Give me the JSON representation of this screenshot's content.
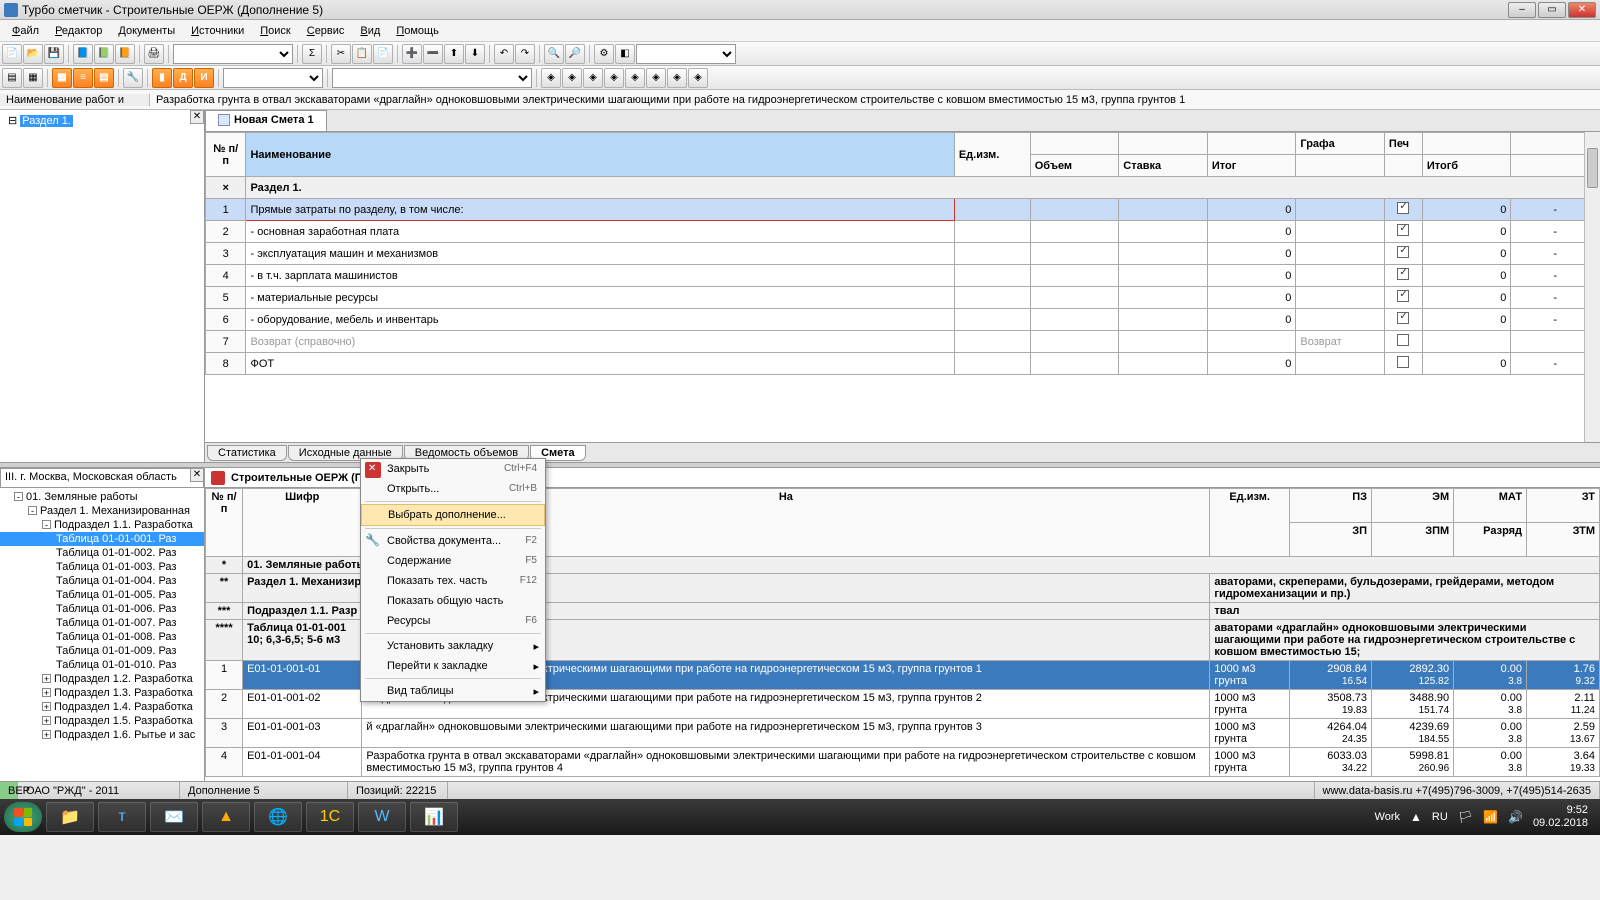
{
  "title": "Турбо сметчик - Строительные ОЕРЖ (Дополнение 5)",
  "menu": [
    "Файл",
    "Редактор",
    "Документы",
    "Источники",
    "Поиск",
    "Сервис",
    "Вид",
    "Помощь"
  ],
  "formula": {
    "label": "Наименование работ и",
    "value": "Разработка грунта в отвал экскаваторами «драглайн» одноковшовыми электрическими шагающими при работе на гидроэнергетическом строительстве с ковшом вместимостью 15 м3, группа грунтов 1"
  },
  "sections_tree": {
    "root": "Раздел 1."
  },
  "doc_tab": "Новая Смета 1",
  "est_headers": {
    "num": "№ п/п",
    "name": "Наименование",
    "unit": "Ед.изм.",
    "vol": "Объем",
    "rate": "Ставка",
    "itog": "Итог",
    "grafa": "Графа",
    "pech": "Печ",
    "itogb": "Итогб"
  },
  "est_section": "Раздел 1.",
  "est_rows": [
    {
      "n": "1",
      "name": "Прямые затраты по разделу, в том числе:",
      "itog": "0",
      "pech": true,
      "itogb": "0",
      "dash": "-",
      "sel": true
    },
    {
      "n": "2",
      "name": "   - основная заработная плата",
      "itog": "0",
      "pech": true,
      "itogb": "0",
      "dash": "-"
    },
    {
      "n": "3",
      "name": "   - эксплуатация машин и механизмов",
      "itog": "0",
      "pech": true,
      "itogb": "0",
      "dash": "-"
    },
    {
      "n": "4",
      "name": "     - в т.ч. зарплата машинистов",
      "itog": "0",
      "pech": true,
      "itogb": "0",
      "dash": "-"
    },
    {
      "n": "5",
      "name": "   - материальные ресурсы",
      "itog": "0",
      "pech": true,
      "itogb": "0",
      "dash": "-"
    },
    {
      "n": "6",
      "name": "   - оборудование, мебель и инвентарь",
      "itog": "0",
      "pech": true,
      "itogb": "0",
      "dash": "-"
    },
    {
      "n": "7",
      "name": "Возврат (справочно)",
      "itog": "",
      "pech": false,
      "itogb": "Возврат",
      "dash": "",
      "gray": true
    },
    {
      "n": "8",
      "name": "ФОТ",
      "itog": "0",
      "pech": false,
      "itogb": "0",
      "dash": "-"
    }
  ],
  "est_bottom_tabs": [
    "Статистика",
    "Исходные данные",
    "Ведомость объемов",
    "Смета"
  ],
  "est_bottom_active": 3,
  "db_region": "III. г. Москва, Московская область",
  "db_tree": {
    "root": "01. Земляные работы",
    "sec1": "Раздел 1. Механизированная",
    "sub": "Подраздел 1.1. Разработка",
    "tables": [
      "Таблица 01-01-001. Раз",
      "Таблица 01-01-002. Раз",
      "Таблица 01-01-003. Раз",
      "Таблица 01-01-004. Раз",
      "Таблица 01-01-005. Раз",
      "Таблица 01-01-006. Раз",
      "Таблица 01-01-007. Раз",
      "Таблица 01-01-008. Раз",
      "Таблица 01-01-009. Раз",
      "Таблица 01-01-010. Раз"
    ],
    "subs": [
      "Подраздел 1.2. Разработка",
      "Подраздел 1.3. Разработка",
      "Подраздел 1.4. Разработка",
      "Подраздел 1.5. Разработка",
      "Подраздел 1.6. Рытье и зас"
    ]
  },
  "db_title": "Строительные ОЕРЖ (Подрайон III)",
  "db_headers": {
    "num": "№ п/п",
    "code": "Шифр",
    "name": "На",
    "unit": "Ед.изм.",
    "pz": "ПЗ",
    "em": "ЭМ",
    "mat": "МАТ",
    "zt": "ЗТ",
    "zp": "ЗП",
    "zpm": "ЗПМ",
    "razr": "Разряд",
    "ztm": "ЗТМ"
  },
  "db_groups": {
    "g1": "01. Земляные работы",
    "g2": "Раздел 1. Механизир",
    "g2b": "аваторами, скреперами, бульдозерами, грейдерами, методом гидромеханизации и пр.)",
    "g3": "Подраздел 1.1. Разр",
    "g3b": "твал",
    "g4a": "Таблица 01-01-001",
    "g4b": "аваторами «драглайн» одноковшовыми электрическими шагающими при работе на гидроэнергетическом строительстве с ковшом вместимостью 15;",
    "g4c": "10; 6,3-6,5; 5-6 м3"
  },
  "db_rows": [
    {
      "n": "1",
      "code": "E01-01-001-01",
      "name": "Ра\nстр",
      "desc": "й «драглайн» одноковшовыми электрическими шагающими при работе на гидроэнергетическом 15 м3, группа грунтов 1",
      "unit": "1000 м3 грунта",
      "pz": "2908.84",
      "em": "2892.30",
      "mat": "0.00",
      "zt": "1.76",
      "zp": "16.54",
      "zpm": "125.82",
      "razr": "3.8",
      "ztm": "9.32",
      "sel": true
    },
    {
      "n": "2",
      "code": "E01-01-001-02",
      "name": "Ра\nстр",
      "desc": "й «драглайн» одноковшовыми электрическими шагающими при работе на гидроэнергетическом 15 м3, группа грунтов 2",
      "unit": "1000 м3 грунта",
      "pz": "3508.73",
      "em": "3488.90",
      "mat": "0.00",
      "zt": "2.11",
      "zp": "19.83",
      "zpm": "151.74",
      "razr": "3.8",
      "ztm": "11.24"
    },
    {
      "n": "3",
      "code": "E01-01-001-03",
      "name": "Ра\nстр",
      "desc": "й «драглайн» одноковшовыми электрическими шагающими при работе на гидроэнергетическом 15 м3, группа грунтов 3",
      "unit": "1000 м3 грунта",
      "pz": "4264.04",
      "em": "4239.69",
      "mat": "0.00",
      "zt": "2.59",
      "zp": "24.35",
      "zpm": "184.55",
      "razr": "3.8",
      "ztm": "13.67"
    },
    {
      "n": "4",
      "code": "E01-01-001-04",
      "name": "Разработка грунта в отвал экскаваторами «драглайн» одноковшовыми электрическими шагающими при работе на гидроэнергетическом строительстве с ковшом вместимостью 15 м3, группа грунтов 4",
      "desc": "",
      "unit": "1000 м3 грунта",
      "pz": "6033.03",
      "em": "5998.81",
      "mat": "0.00",
      "zt": "3.64",
      "zp": "34.22",
      "zpm": "260.96",
      "razr": "3.8",
      "ztm": "19.33"
    }
  ],
  "context_menu": [
    {
      "label": "Закрыть",
      "shortcut": "Ctrl+F4",
      "icon": "close"
    },
    {
      "label": "Открыть...",
      "shortcut": "Ctrl+B"
    },
    {
      "sep": true
    },
    {
      "label": "Выбрать дополнение...",
      "hl": true
    },
    {
      "sep": true
    },
    {
      "label": "Свойства документа...",
      "shortcut": "F2",
      "icon": "wrench"
    },
    {
      "label": "Содержание",
      "shortcut": "F5"
    },
    {
      "label": "Показать тех. часть",
      "shortcut": "F12"
    },
    {
      "label": "Показать общую часть"
    },
    {
      "label": "Ресурсы",
      "shortcut": "F6"
    },
    {
      "sep": true
    },
    {
      "label": "Установить закладку",
      "sub": true
    },
    {
      "label": "Перейти к закладке",
      "sub": true
    },
    {
      "sep": true
    },
    {
      "label": "Вид таблицы",
      "sub": true
    }
  ],
  "status": {
    "ver": "ВЕР",
    "company": "ОАО \"РЖД\" - 2011",
    "supplement": "Дополнение 5",
    "positions": "Позиций: 22215",
    "site": "www.data-basis.ru  +7(495)796-3009, +7(495)514-2635"
  },
  "tray": {
    "work": "Work",
    "lang": "RU",
    "time": "9:52",
    "date": "09.02.2018"
  }
}
